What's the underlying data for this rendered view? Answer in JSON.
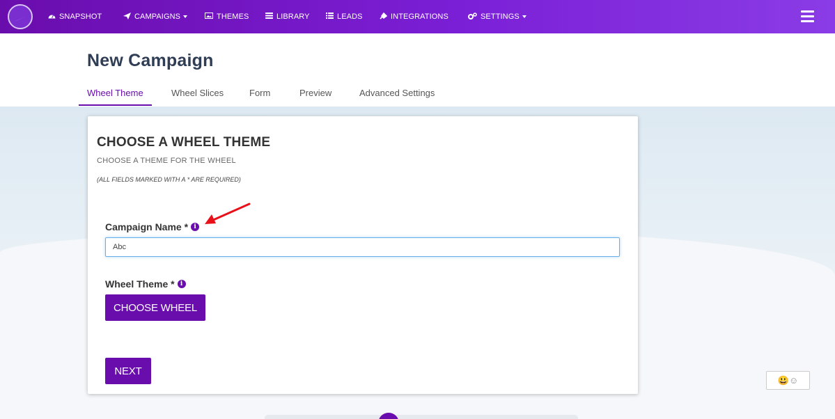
{
  "nav": {
    "items": [
      {
        "label": "SNAPSHOT",
        "icon": "dashboard-icon"
      },
      {
        "label": "CAMPAIGNS",
        "icon": "paper-plane-icon",
        "caret": true
      },
      {
        "label": "THEMES",
        "icon": "image-icon"
      },
      {
        "label": "LIBRARY",
        "icon": "list-alt-icon"
      },
      {
        "label": "LEADS",
        "icon": "list-icon"
      },
      {
        "label": "INTEGRATIONS",
        "icon": "plug-icon"
      },
      {
        "label": "SETTINGS",
        "icon": "cogs-icon",
        "caret": true
      }
    ]
  },
  "page": {
    "title": "New Campaign"
  },
  "tabs": [
    {
      "label": "Wheel Theme",
      "active": true
    },
    {
      "label": "Wheel Slices"
    },
    {
      "label": "Form"
    },
    {
      "label": "Preview"
    },
    {
      "label": "Advanced Settings"
    }
  ],
  "card": {
    "title": "CHOOSE A WHEEL THEME",
    "subtitle": "CHOOSE A THEME FOR THE WHEEL",
    "required_note": "(ALL FIELDS MARKED WITH A * ARE REQUIRED)",
    "campaign_name_label": "Campaign Name *",
    "campaign_name_value": "Abc",
    "wheel_theme_label": "Wheel Theme *",
    "choose_wheel_label": "CHOOSE WHEEL",
    "next_label": "NEXT"
  },
  "colors": {
    "accent": "#6a0dad",
    "nav_gradient_end": "#8a3ce6",
    "title": "#2f3d55",
    "annotation_arrow": "#e8111a"
  }
}
